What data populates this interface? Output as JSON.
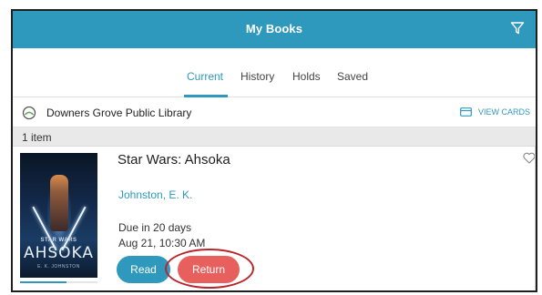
{
  "header": {
    "title": "My Books",
    "filter_icon": "filter-icon"
  },
  "tabs": [
    {
      "label": "Current",
      "active": true
    },
    {
      "label": "History",
      "active": false
    },
    {
      "label": "Holds",
      "active": false
    },
    {
      "label": "Saved",
      "active": false
    }
  ],
  "library": {
    "name": "Downers Grove Public Library",
    "view_cards_label": "VIEW CARDS",
    "logo_icon": "library-logo-icon",
    "cards_icon": "card-icon"
  },
  "list": {
    "count_label": "1 item"
  },
  "book": {
    "title": "Star Wars: Ahsoka",
    "author": "Johnston, E. K.",
    "due": "Due in 20 days",
    "due_date": "Aug 21, 10:30 AM",
    "read_label": "Read",
    "return_label": "Return",
    "reading_progress_fraction": 0.6,
    "cover": {
      "series_logo": "STAR WARS",
      "title": "AHSOKA",
      "author": "E. K. JOHNSTON"
    }
  },
  "colors": {
    "accent": "#2f98bd",
    "return_button": "#e8605e",
    "highlight_circle": "#b8262c"
  }
}
